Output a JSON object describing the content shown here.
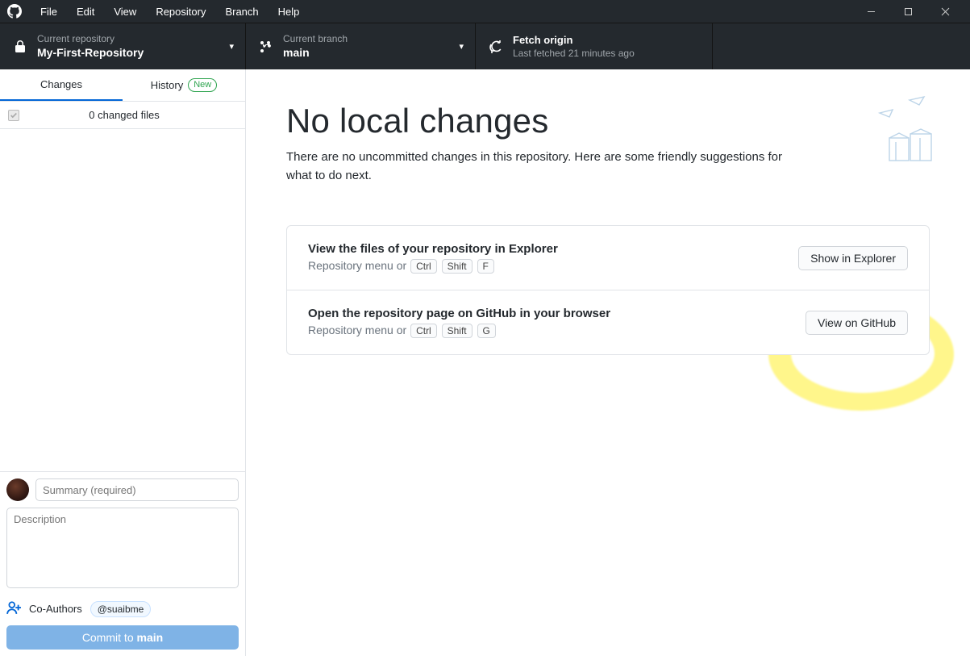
{
  "menubar": {
    "items": [
      "File",
      "Edit",
      "View",
      "Repository",
      "Branch",
      "Help"
    ]
  },
  "toolbar": {
    "repo": {
      "label": "Current repository",
      "value": "My-First-Repository"
    },
    "branch": {
      "label": "Current branch",
      "value": "main"
    },
    "fetch": {
      "label": "Fetch origin",
      "value": "Last fetched 21 minutes ago"
    }
  },
  "tabs": {
    "changes": "Changes",
    "history": "History",
    "new_badge": "New"
  },
  "files": {
    "count_text": "0 changed files"
  },
  "commit": {
    "summary_placeholder": "Summary (required)",
    "description_placeholder": "Description",
    "coauthors_label": "Co-Authors",
    "coauthor_chip": "@suaibme",
    "button_prefix": "Commit to ",
    "button_branch": "main"
  },
  "main": {
    "title": "No local changes",
    "subtitle": "There are no uncommitted changes in this repository. Here are some friendly suggestions for what to do next."
  },
  "cards": [
    {
      "title": "View the files of your repository in Explorer",
      "hint_prefix": "Repository menu or ",
      "keys": [
        "Ctrl",
        "Shift",
        "F"
      ],
      "button": "Show in Explorer"
    },
    {
      "title": "Open the repository page on GitHub in your browser",
      "hint_prefix": "Repository menu or ",
      "keys": [
        "Ctrl",
        "Shift",
        "G"
      ],
      "button": "View on GitHub"
    }
  ]
}
